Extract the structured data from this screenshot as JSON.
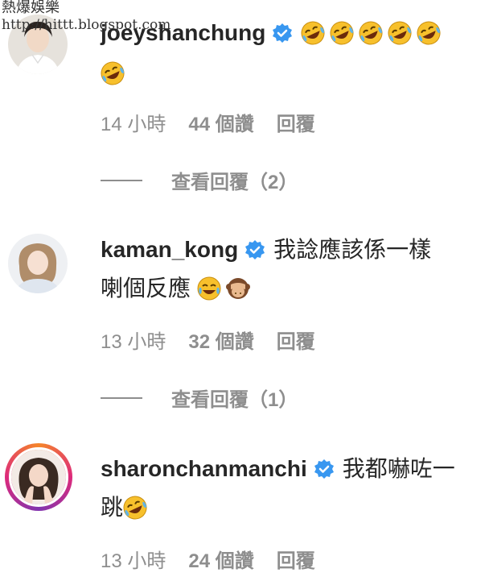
{
  "watermark": {
    "line1": "熱爆娛樂",
    "line2": "http://hittt.blogspot.com"
  },
  "comments": [
    {
      "username": "joeyshanchung",
      "text": "",
      "emoji_count": 6,
      "emoji_icon": "rolling-on-floor-laughing-icon",
      "time": "14 小時",
      "likes": "44 個讚",
      "reply": "回覆",
      "view_replies": "查看回覆（2）"
    },
    {
      "username": "kaman_kong",
      "text_line1": "我諗應該係一樣",
      "text_line2": "喇個反應",
      "emoji_icons": [
        "face-with-tears-of-joy-icon",
        "see-no-evil-monkey-icon"
      ],
      "time": "13 小時",
      "likes": "32 個讚",
      "reply": "回覆",
      "view_replies": "查看回覆（1）"
    },
    {
      "username": "sharonchanmanchi",
      "text_line1": "我都嚇咗一",
      "text_line2": "跳",
      "emoji_icon": "rolling-on-floor-laughing-icon",
      "time": "13 小時",
      "likes": "24 個讚",
      "reply": "回覆"
    }
  ],
  "colors": {
    "verified": "#3897f0",
    "meta": "#8e8e8e",
    "text": "#262626",
    "emoji": "#f7c02c"
  }
}
